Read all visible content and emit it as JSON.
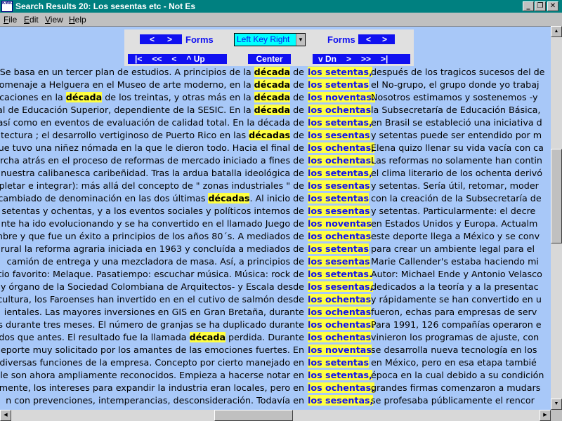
{
  "window": {
    "title": "Search Results 20:  Los sesentas etc - Not Es",
    "icon_label": "KWIC",
    "minimize": "_",
    "restore": "❐",
    "close": "✕"
  },
  "menu": [
    "File",
    "Edit",
    "View",
    "Help"
  ],
  "toolbar": {
    "forms_label": "Forms",
    "prev": "<",
    "next": ">",
    "key_select_value": "Left Key Right",
    "first": "|<",
    "page_back": "<<",
    "back": "<",
    "up": "^ Up",
    "center": "Center",
    "down": "v Dn",
    "forward": ">",
    "page_forward": ">>",
    "last": ">|"
  },
  "results": [
    {
      "left": "Se basa en un tercer plan de estudios. A principios de la |década| de",
      "kw": "los setentas,",
      "right": "después de los tragicos sucesos del de"
    },
    {
      "left": "omenaje a Helguera en el Museo de arte moderno, en la |década| de",
      "kw": "los setentas",
      "right": "el No-grupo, el grupo donde yo trabaj"
    },
    {
      "left": "ificaciones en la |década| de los treintas, y otras más en la |década| de",
      "kw": "los noventas.",
      "right": "Nosotros estimamos y sostenemos -y"
    },
    {
      "left": "ral de Educación Superior, dependiente de la SESIC. En la |década| de",
      "kw": "los ochentas",
      "right": "la Subsecretaría de Educación Básica,"
    },
    {
      "left": "así como en eventos de evaluación de calidad total. En la década de",
      "kw": "los setentas,",
      "right": "en Brasil se estableció una iniciativa d"
    },
    {
      "left": "itectura ; el desarrollo vertiginoso de Puerto Rico en las |décadas| de",
      "kw": "los sesentas",
      "right": "y setentas puede ser entendido por m"
    },
    {
      "left": "ue tuvo una niñez nómada en la que le dieron todo. Hacia el final de",
      "kw": "los ochentas,",
      "right": "Elena quizo llenar su vida vacía con ca"
    },
    {
      "left": "archa atrás en el proceso de reformas de mercado iniciado a fines de",
      "kw": "los ochentas.",
      "right": "Las reformas no solamente han contin"
    },
    {
      "left": "nuestra calibanesca caribeñidad. Tras la ardua batalla ideológica de",
      "kw": "los setentas,",
      "right": "el clima literario de los ochenta derivó"
    },
    {
      "left": "lpletar e integrar): más allá del concepto de \" zonas industriales \" de",
      "kw": "los sesentas",
      "right": "y setentas. Sería útil, retomar, moder"
    },
    {
      "left": "n cambiado de denominación en las dos últimas |décadas|. Al inicio de",
      "kw": "los setentas",
      "right": "con la creación de la Subsecretaría de"
    },
    {
      "left": "setentas y ochentas, y a los eventos sociales y políticos internos de",
      "kw": "los sesentas",
      "right": "y setentas. Particularmente: el decre"
    },
    {
      "left": "nte ha ido evolucionando y se ha convertido en el llamado Juego de",
      "kw": "los noventas",
      "right": "en Estados Unidos y Europa. Actualm"
    },
    {
      "left": "mbre y que fue un éxito a principios de los años 80´s. A mediados de",
      "kw": "los ochentas",
      "right": "este deporte llega a México y se conv"
    },
    {
      "left": "n rural la reforma agraria iniciada en 1963 y concluída a mediados de",
      "kw": "los setentas",
      "right": "para crear un ambiente legal para el"
    },
    {
      "left": "camión de entrega y una mezcladora de masa. Así, a principios de",
      "kw": "los sesentas",
      "right": "Marie Callender's estaba haciendo mi"
    },
    {
      "left": "tio favorito: Melaque. Pasatiempo: escuchar música. Música: rock de",
      "kw": "los setentas.",
      "right": "Autor: Michael Ende y Antonio Velasco"
    },
    {
      "left": "y órgano de la Sociedad Colombiana de Arquitectos- y Escala desde",
      "kw": "los sesentas,",
      "right": "dedicados a la teoría y a la presentac"
    },
    {
      "left": "cultura, los Faroenses han invertido en en el cutivo de salmón desde",
      "kw": "los ochentas",
      "right": "y rápidamente se han convertido en u"
    },
    {
      "left": "ientales. Las mayores inversiones en GIS en Gran Bretaña, durante",
      "kw": "los ochentas",
      "right": "fueron, echas para empresas de serv"
    },
    {
      "left": "s durante tres meses. El número de granjas se ha duplicado durante",
      "kw": "los ochentas.",
      "right": "Para 1991, 126 compañías operaron e"
    },
    {
      "left": "ados que antes. El resultado fue la llamada |década| perdida. Durante",
      "kw": "los ochentas",
      "right": "vinieron los programas de ajuste, con"
    },
    {
      "left": "deporte muy solicitado por los amantes de las emociones fuertes. En",
      "kw": "los noventas",
      "right": "se desarrolla nueva tecnología en los"
    },
    {
      "left": "diversas funciones de la empresa. Concepto por cierto manejado en",
      "kw": "los setentas",
      "right": "en México, pero en esa etapa tambié"
    },
    {
      "left": "le son ahora ampliamente reconocidos. Empieza a hacerse notar en",
      "kw": "los setentas,",
      "right": "época en la cual debido a su condición"
    },
    {
      "left": "mente, los intereses para expandir la industria eran locales, pero en",
      "kw": "los ochentas,",
      "right": "grandes firmas comenzaron a mudars"
    },
    {
      "left": "n con prevenciones, intemperancias, desconsideración. Todavía en",
      "kw": "los sesentas,",
      "right": "se profesaba públicamente el rencor"
    }
  ],
  "colors": {
    "title_bar": "#008080",
    "content_bg": "#a8c8f8",
    "nav_blue": "#1010f0",
    "highlight": "#ffff40",
    "select_bg": "#00ffff"
  }
}
